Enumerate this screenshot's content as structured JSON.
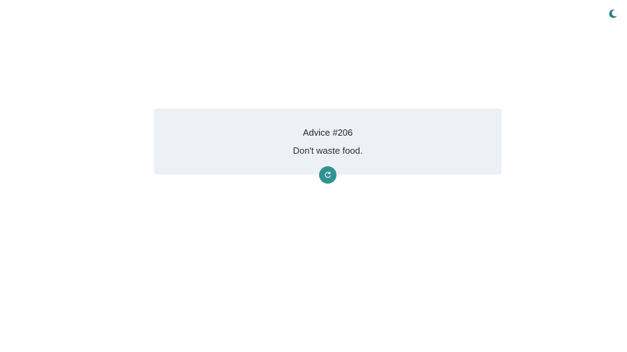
{
  "header": {
    "theme_toggle_icon": "moon-icon",
    "accent_color": "#2f9391"
  },
  "card": {
    "title": "Advice #206",
    "advice": "Don't waste food.",
    "background_color": "#edf1f5"
  },
  "actions": {
    "refresh_icon": "refresh-icon"
  }
}
